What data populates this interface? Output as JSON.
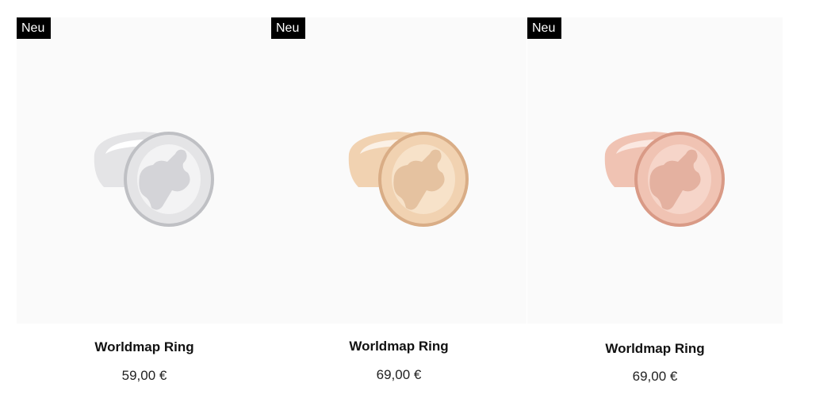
{
  "products": [
    {
      "badge": "Neu",
      "name": "Worldmap Ring",
      "price": "59,00 €",
      "metal_color": "#e4e4e6",
      "metal_shade": "#bfc0c4",
      "metal_highlight": "#ffffff"
    },
    {
      "badge": "Neu",
      "name": "Worldmap Ring",
      "price": "69,00 €",
      "metal_color": "#f1d2b1",
      "metal_shade": "#d9ad86",
      "metal_highlight": "#fbeedd"
    },
    {
      "badge": "Neu",
      "name": "Worldmap Ring",
      "price": "69,00 €",
      "metal_color": "#f0c3b3",
      "metal_shade": "#d99a86",
      "metal_highlight": "#fbe3da"
    }
  ]
}
